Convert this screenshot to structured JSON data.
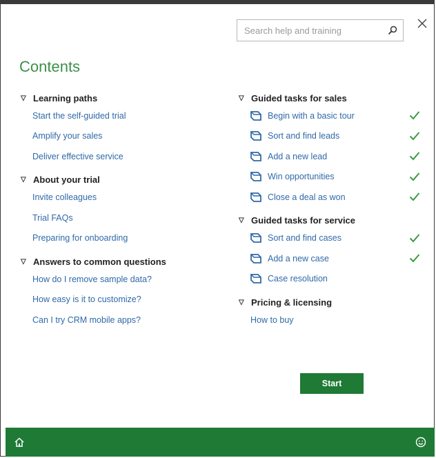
{
  "search": {
    "placeholder": "Search help and training"
  },
  "title": "Contents",
  "left_sections": [
    {
      "heading": "Learning paths",
      "links": [
        "Start the self-guided trial",
        "Amplify your sales",
        "Deliver effective service"
      ]
    },
    {
      "heading": "About your trial",
      "links": [
        "Invite colleagues",
        "Trial FAQs",
        "Preparing for onboarding"
      ]
    },
    {
      "heading": "Answers to common questions",
      "links": [
        "How do I remove sample data?",
        "How easy is it to customize?",
        "Can I try CRM mobile apps?"
      ]
    }
  ],
  "right_sections": [
    {
      "heading": "Guided tasks for sales",
      "tasks": [
        {
          "label": "Begin with a basic tour",
          "done": true
        },
        {
          "label": "Sort and find leads",
          "done": true
        },
        {
          "label": "Add a new lead",
          "done": true
        },
        {
          "label": "Win opportunities",
          "done": true
        },
        {
          "label": "Close a deal as won",
          "done": true
        }
      ]
    },
    {
      "heading": "Guided tasks for service",
      "tasks": [
        {
          "label": "Sort and find cases",
          "done": true
        },
        {
          "label": "Add a new case",
          "done": true
        },
        {
          "label": "Case resolution",
          "done": false
        }
      ]
    },
    {
      "heading": "Pricing & licensing",
      "links": [
        "How to buy"
      ]
    }
  ],
  "start_label": "Start",
  "colors": {
    "accent": "#1f7a36",
    "title": "#3f8f4a",
    "link": "#2f69a8",
    "check": "#3c9a3f"
  },
  "icons": {
    "search": "search-icon",
    "close": "close-icon",
    "home": "home-icon",
    "feedback": "smiley-icon",
    "task": "guided-task-icon",
    "done": "checkmark-icon"
  }
}
